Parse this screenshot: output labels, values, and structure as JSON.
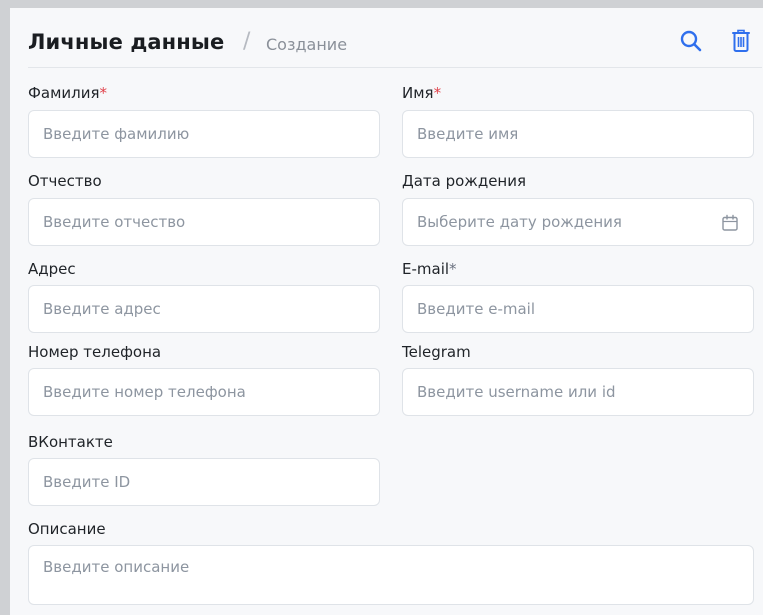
{
  "header": {
    "title": "Личные данные",
    "separator": "/",
    "subtitle": "Создание",
    "icons": [
      "search-icon",
      "trash-icon"
    ]
  },
  "form": {
    "last_name": {
      "label": "Фамилия",
      "required_mark": "*",
      "placeholder": "Введите фамилию"
    },
    "first_name": {
      "label": "Имя",
      "required_mark": "*",
      "placeholder": "Введите имя"
    },
    "middle_name": {
      "label": "Отчество",
      "placeholder": "Введите отчество"
    },
    "birth_date": {
      "label": "Дата рождения",
      "placeholder": "Выберите дату рождения",
      "icon": "calendar-icon"
    },
    "address": {
      "label": "Адрес",
      "placeholder": "Введите адрес"
    },
    "email": {
      "label": "E-mail",
      "required_mark": "*",
      "placeholder": "Введите e-mail"
    },
    "phone": {
      "label": "Номер телефона",
      "placeholder": "Введите номер телефона"
    },
    "telegram": {
      "label": "Telegram",
      "placeholder": "Введите username или id"
    },
    "vk": {
      "label": "ВКонтакте",
      "placeholder": "Введите ID"
    },
    "description": {
      "label": "Описание",
      "placeholder": "Введите описание"
    }
  },
  "colors": {
    "accent": "#2f6fed",
    "required": "#e0414a",
    "panel_bg": "#f7f8fa",
    "input_border": "#dfe3e8"
  }
}
